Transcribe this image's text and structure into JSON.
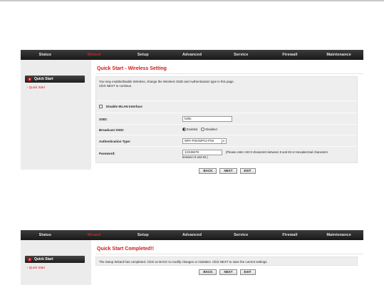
{
  "nav": {
    "items": [
      "Status",
      "Wizard",
      "Setup",
      "Advanced",
      "Service",
      "Firewall",
      "Maintenance"
    ],
    "active": "Wizard"
  },
  "sidebar": {
    "button_label": "Quick Start",
    "link_label": "Quick Start"
  },
  "wireless": {
    "title": "Quick Start - Wireless Setting",
    "intro_line1": "You may enable/disable Wireless, change the Wireless SSID and Authentication type in this page.",
    "intro_line2": "Click NEXT to continue.",
    "disable_label": "Disable WLAN Interface",
    "ssid_label": "SSID:",
    "ssid_value": "hello",
    "broadcast_label": "Broadcast SSID:",
    "broadcast_enabled": "Enabled",
    "broadcast_disabled": "Disabled",
    "auth_label": "Authentication Type:",
    "auth_value": "WPA-PSK/WPA2-PSK",
    "password_label": "Password:",
    "password_value": "12345678",
    "password_hint": "(Please enter ASCII characters between 8 and 63 or Hexadecimal characters",
    "password_hint2": "between 8 and 64.)"
  },
  "buttons": {
    "back": "BACK",
    "next": "NEXT",
    "exit": "EXIT"
  },
  "completed": {
    "title": "Quick Start Completed!!",
    "message": "The Setup Wizard has completed. Click on BACK to modify changes or mistakes. Click NEXT to save the current settings."
  },
  "colors": {
    "accent": "#d31818",
    "navbar": "#2a2a2a",
    "panel_bg": "#eeeeee"
  }
}
